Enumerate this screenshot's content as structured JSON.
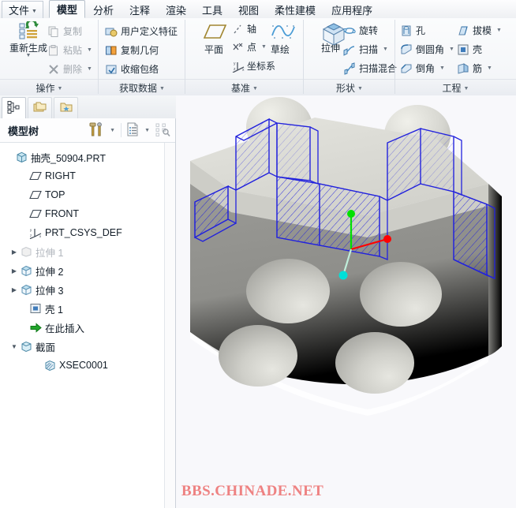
{
  "app": {
    "file_menu": "文件",
    "tabs": [
      {
        "label": "模型",
        "active": true
      },
      {
        "label": "分析",
        "active": false
      },
      {
        "label": "注释",
        "active": false
      },
      {
        "label": "渲染",
        "active": false
      },
      {
        "label": "工具",
        "active": false
      },
      {
        "label": "视图",
        "active": false
      },
      {
        "label": "柔性建模",
        "active": false
      },
      {
        "label": "应用程序",
        "active": false
      }
    ]
  },
  "ribbon": {
    "groups": [
      {
        "name": "操作",
        "label": "操作"
      },
      {
        "name": "获取数据",
        "label": "获取数据"
      },
      {
        "name": "基准",
        "label": "基准"
      },
      {
        "name": "形状",
        "label": "形状"
      },
      {
        "name": "工程",
        "label": "工程"
      }
    ],
    "operations": {
      "regenerate": "重新生成",
      "copy": "复制",
      "paste": "粘贴",
      "delete": "删除"
    },
    "get_data": {
      "udf": "用户定义特征",
      "copy_geom": "复制几何",
      "shrinkwrap": "收缩包络"
    },
    "datum": {
      "plane": "平面",
      "axis": "轴",
      "point": "点",
      "csys": "坐标系",
      "sketch": "草绘"
    },
    "shape": {
      "extrude": "拉伸",
      "revolve": "旋转",
      "sweep": "扫描",
      "swept_blend": "扫描混合"
    },
    "engineering": {
      "hole": "孔",
      "round": "倒圆角",
      "chamfer": "倒角",
      "draft": "拔模",
      "shell": "壳",
      "rib": "筋"
    }
  },
  "left_panel": {
    "title": "模型树",
    "tabs": [
      {
        "name": "model-tree-tab",
        "icon": "tree-icon",
        "active": true
      },
      {
        "name": "folder-browser-tab",
        "icon": "folders-icon",
        "active": false
      },
      {
        "name": "favorites-tab",
        "icon": "folder-star-icon",
        "active": false
      }
    ],
    "toolbar": [
      {
        "name": "settings-tools-button",
        "icon": "hammer-screwdriver-icon"
      },
      {
        "name": "display-settings-button",
        "icon": "list-document-icon"
      },
      {
        "name": "tree-filter-button",
        "icon": "tree-filter-icon"
      }
    ],
    "tree": [
      {
        "label": "抽壳_50904.PRT",
        "icon": "part-icon",
        "indent": 0,
        "arrow": "none",
        "dim": false
      },
      {
        "label": "RIGHT",
        "icon": "plane-icon",
        "indent": 1,
        "arrow": "none",
        "dim": false
      },
      {
        "label": "TOP",
        "icon": "plane-icon",
        "indent": 1,
        "arrow": "none",
        "dim": false
      },
      {
        "label": "FRONT",
        "icon": "plane-icon",
        "indent": 1,
        "arrow": "none",
        "dim": false
      },
      {
        "label": "PRT_CSYS_DEF",
        "icon": "csys-icon",
        "indent": 1,
        "arrow": "none",
        "dim": false
      },
      {
        "label": "拉伸 1",
        "icon": "extrude-icon",
        "indent": 1,
        "arrow": "right",
        "dim": true
      },
      {
        "label": "拉伸 2",
        "icon": "extrude-icon",
        "indent": 1,
        "arrow": "right",
        "dim": false
      },
      {
        "label": "拉伸 3",
        "icon": "extrude-icon",
        "indent": 1,
        "arrow": "right",
        "dim": false
      },
      {
        "label": "壳 1",
        "icon": "shell-icon",
        "indent": 1,
        "arrow": "none",
        "dim": false
      },
      {
        "label": "在此插入",
        "icon": "insert-here-icon",
        "indent": 1,
        "arrow": "none",
        "dim": false
      },
      {
        "label": "截面",
        "icon": "section-icon",
        "indent": 1,
        "arrow": "down",
        "dim": false
      },
      {
        "label": "XSEC0001",
        "icon": "xsec-icon",
        "indent": 2,
        "arrow": "none",
        "dim": false
      }
    ]
  },
  "viewport": {
    "watermark": "BBS.CHINADE.NET",
    "model_name": "抽壳_50904",
    "colors": {
      "background": "#f8f8fb",
      "body_light": "#dcdcd6",
      "body_mid": "#8e8e8a",
      "body_dark": "#6e6e6b",
      "section_line": "#2222dd",
      "axis_x": "#ff0000",
      "axis_y": "#00e000",
      "axis_z": "#00d8d8",
      "watermark": "#ee8282"
    }
  }
}
